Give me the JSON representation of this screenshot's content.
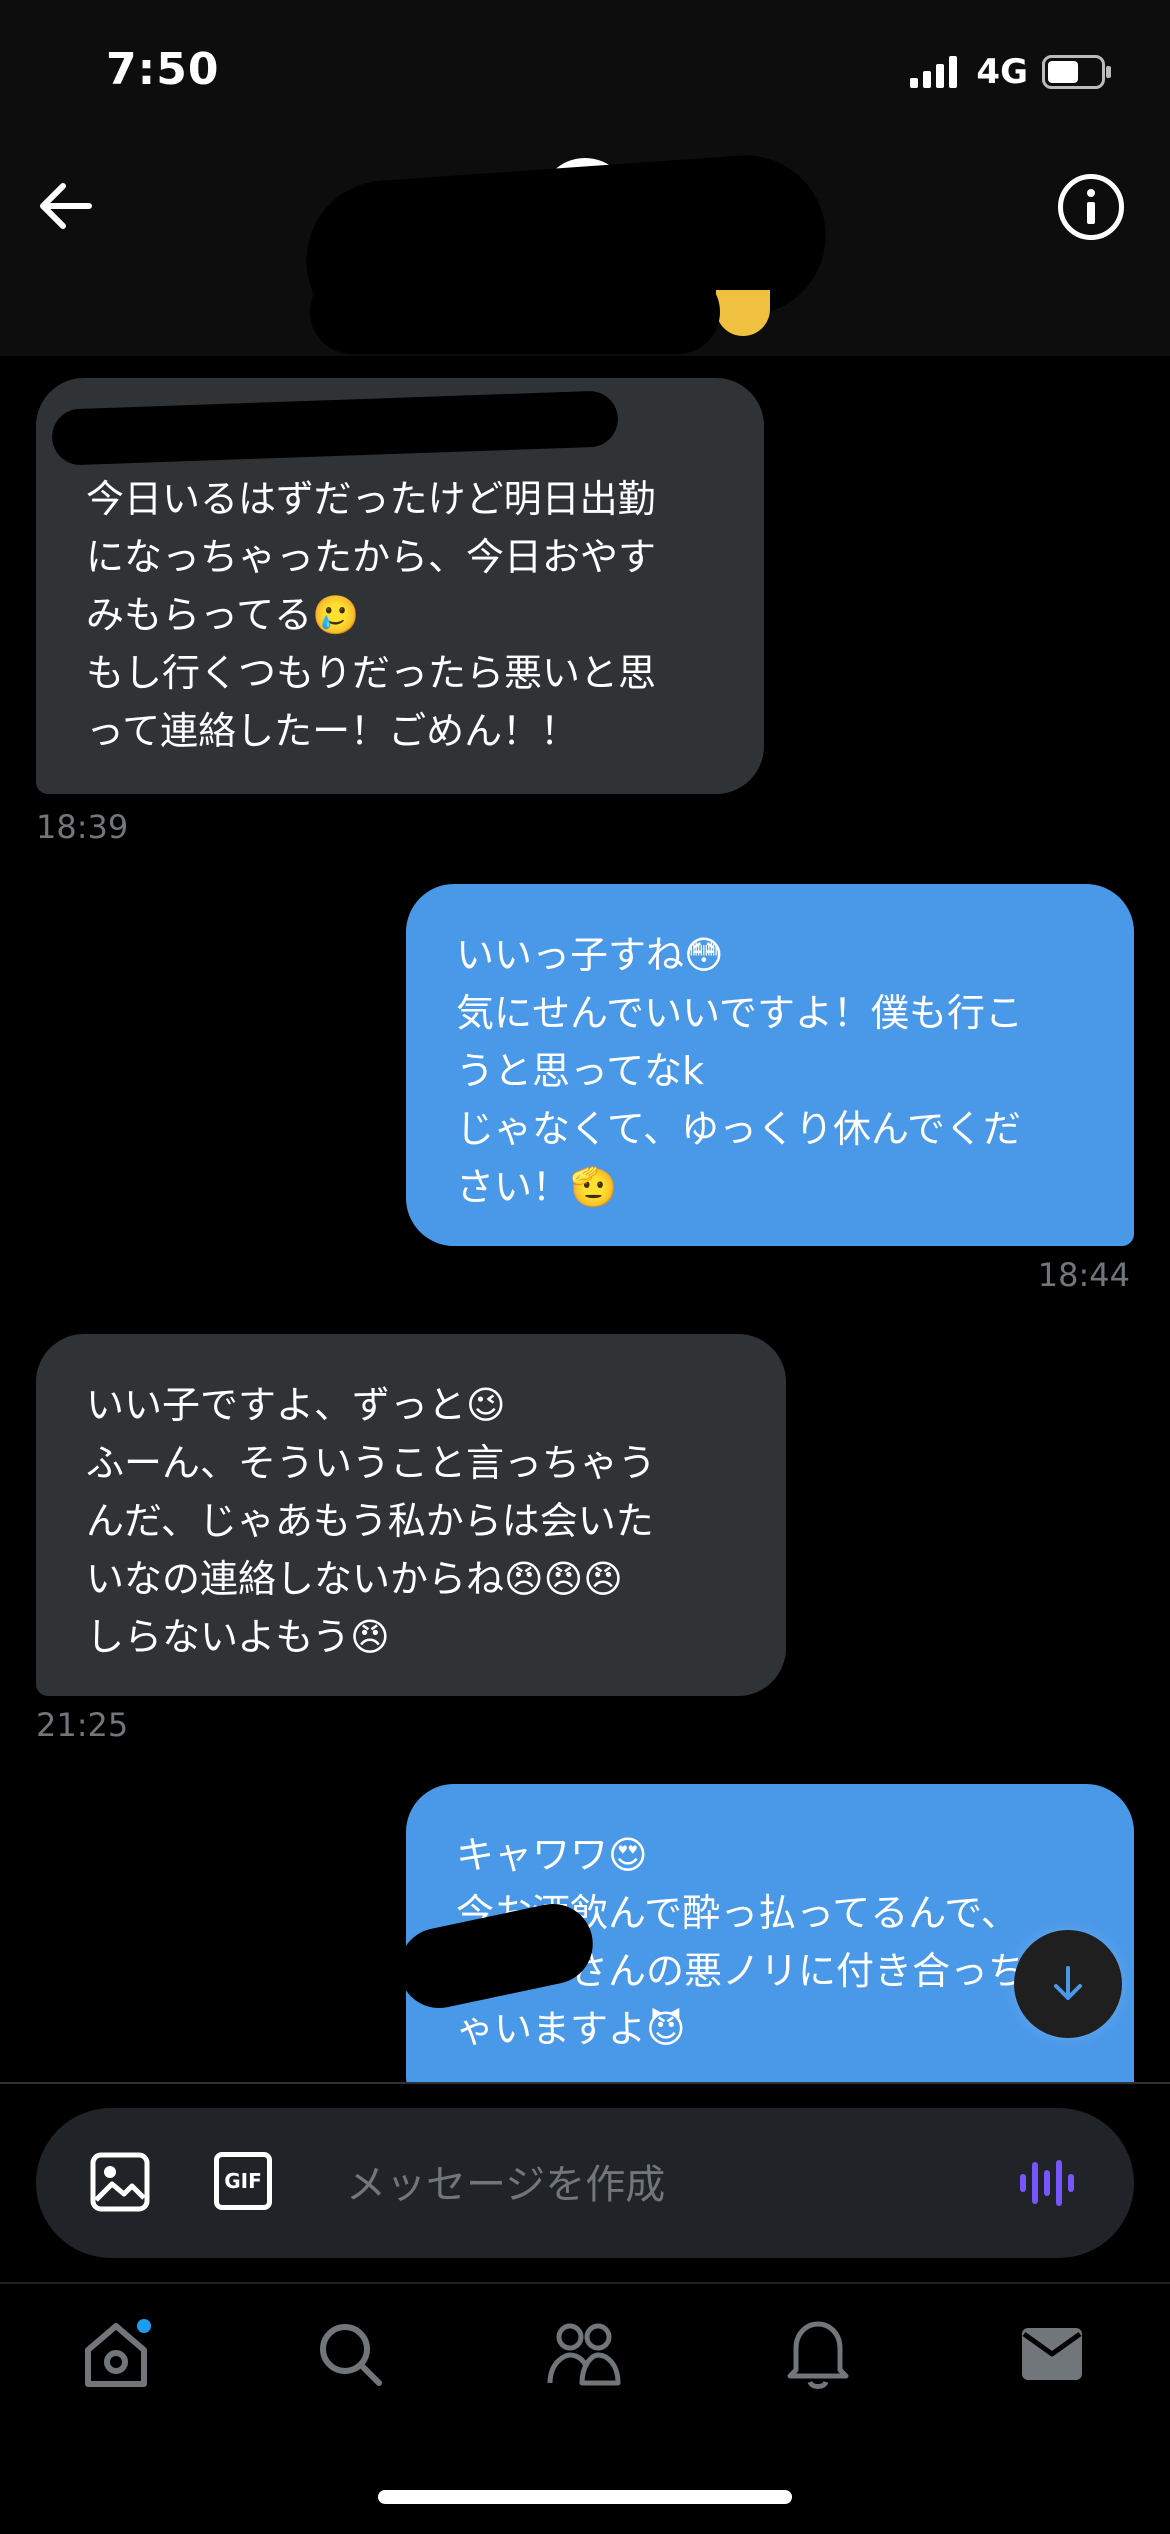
{
  "status_bar": {
    "time": "7:50",
    "network": "4G"
  },
  "header": {
    "back_icon": "arrow-left-icon",
    "info_icon": "info-icon"
  },
  "messages": [
    {
      "direction": "received",
      "text": "今日いるはずだったけど明日出勤\nになっちゃったから、今日おやす\nみもらってる🥲\nもし行くつもりだったら悪いと思\nって連絡したー！ごめん！！",
      "time": "18:39"
    },
    {
      "direction": "sent",
      "text": "いいっ子すね😳\n気にせんでいいですよ！僕も行こ\nうと思ってなk\nじゃなくて、ゆっくり休んでくだ\nさい！🫡",
      "time": "18:44"
    },
    {
      "direction": "received",
      "text": "いい子ですよ、ずっと😉\nふーん、そういうこと言っちゃう\nんだ、じゃあもう私からは会いた\nいなの連絡しないからね😠😠😠\nしらないよもう😠",
      "time": "21:25"
    },
    {
      "direction": "sent",
      "text": "キャワワ😍\n今お酒飲んで酔っ払ってるんで、\n　　　さんの悪ノリに付き合っち\nゃいますよ😈",
      "time": ""
    }
  ],
  "composer": {
    "placeholder": "メッセージを作成",
    "image_icon": "image-icon",
    "gif_label": "GIF",
    "voice_icon": "voice-icon"
  },
  "nav": {
    "items": [
      "home-icon",
      "search-icon",
      "communities-icon",
      "notifications-icon",
      "messages-icon"
    ]
  },
  "colors": {
    "sent_bubble": "#4a99e9",
    "received_bubble": "#2f3336",
    "voice_accent": "#7856ff"
  }
}
